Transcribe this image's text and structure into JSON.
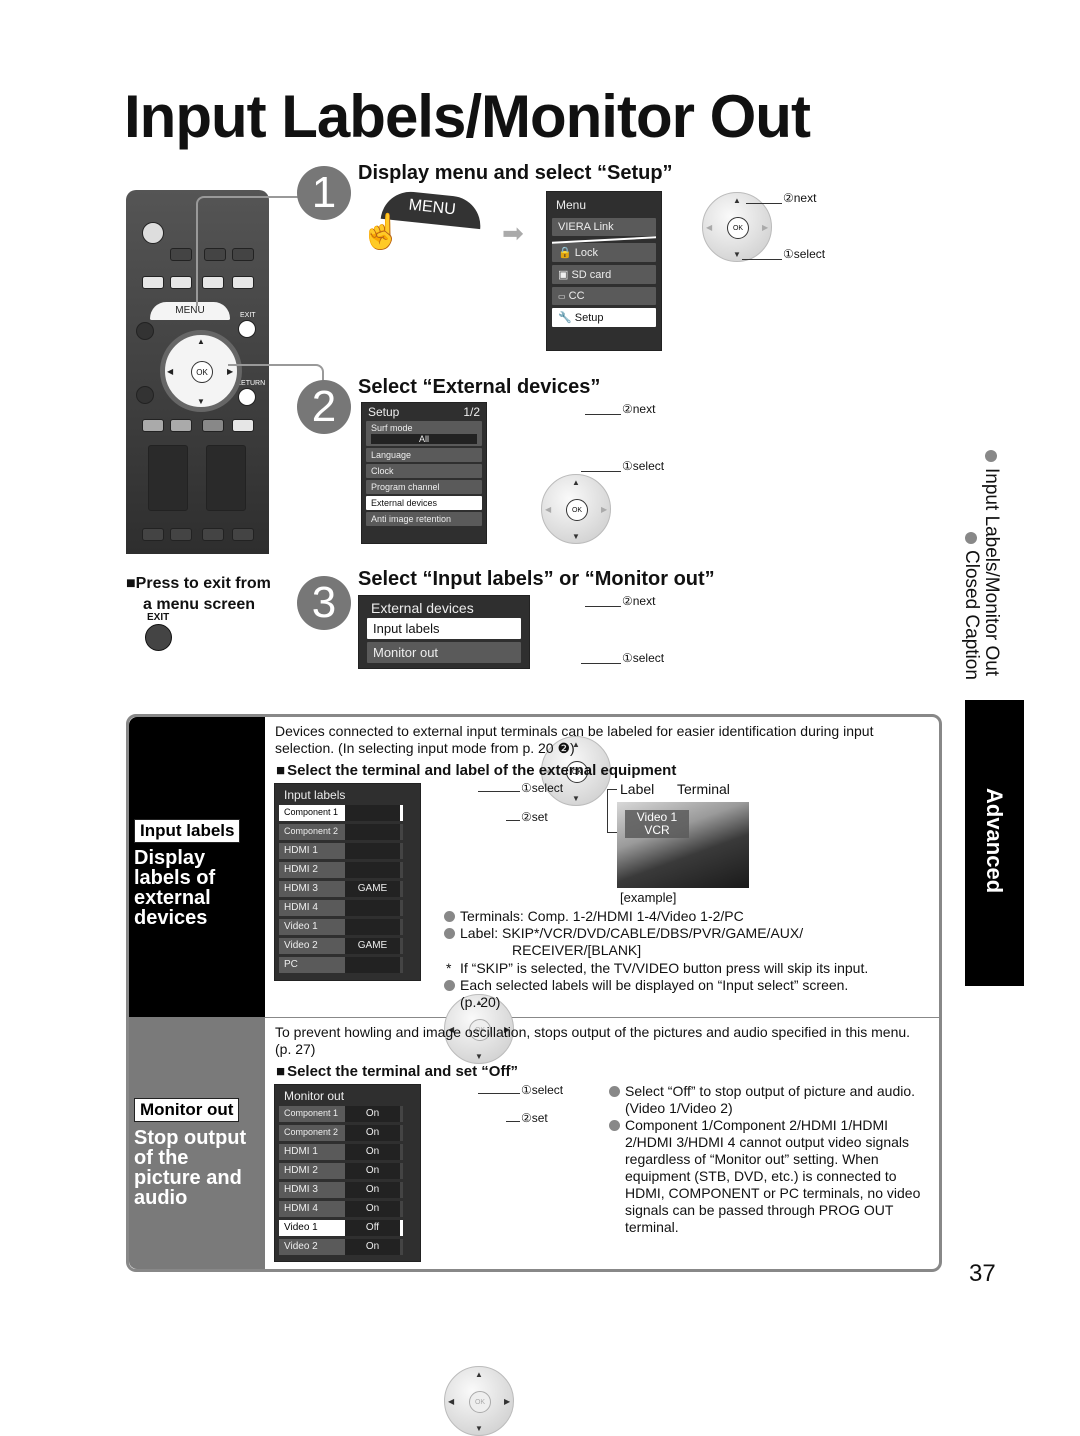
{
  "page": {
    "title": "Input Labels/Monitor Out",
    "page_number": "37"
  },
  "steps": [
    {
      "number": "1",
      "heading": "Display menu and select “Setup”",
      "menu_button_label": "MENU",
      "menu": {
        "title": "Menu",
        "items": [
          {
            "label": "VIERA Link",
            "icon": "",
            "selected": false
          },
          {
            "label": "Lock",
            "icon": "lock-icon",
            "selected": false
          },
          {
            "label": "SD card",
            "icon": "sd-card-icon",
            "selected": false
          },
          {
            "label": "CC",
            "icon": "cc-icon",
            "selected": false
          },
          {
            "label": "Setup",
            "icon": "wrench-icon",
            "selected": true
          }
        ]
      },
      "nav_next": "②next",
      "nav_select": "①select"
    },
    {
      "number": "2",
      "heading": "Select “External devices”",
      "menu": {
        "title": "Setup",
        "page": "1/2",
        "surf_mode_label": "Surf mode",
        "surf_mode_value": "All",
        "items": [
          {
            "label": "Language",
            "selected": false
          },
          {
            "label": "Clock",
            "selected": false
          },
          {
            "label": "Program channel",
            "selected": false
          },
          {
            "label": "External devices",
            "selected": true
          },
          {
            "label": "Anti image retention",
            "selected": false
          }
        ]
      },
      "nav_next": "②next",
      "nav_select": "①select"
    },
    {
      "number": "3",
      "heading": "Select “Input labels” or “Monitor out”",
      "menu": {
        "title": "External devices",
        "items": [
          {
            "label": "Input labels",
            "selected": true
          },
          {
            "label": "Monitor out",
            "selected": false
          }
        ]
      },
      "nav_next": "②next",
      "nav_select": "①select"
    }
  ],
  "remote": {
    "menu_label": "MENU",
    "exit_label": "EXIT",
    "return_label": "RETURN",
    "ok_label": "OK"
  },
  "exit_note": {
    "line1": "Press to exit from",
    "line2": "a menu screen",
    "button_label": "EXIT"
  },
  "input_labels": {
    "tag": "Input labels",
    "band_text": [
      "Display",
      "labels of",
      "external",
      "devices"
    ],
    "intro": "Devices connected to external input terminals can be labeled for easier identification during input selection. (In selecting input mode from p. 20 ❷)",
    "subheading": "Select the terminal and label of the external equipment",
    "menu": {
      "title": "Input labels",
      "rows": [
        {
          "terminal": "Component 1",
          "label": "",
          "selected": true
        },
        {
          "terminal": "Component 2",
          "label": "",
          "selected": false
        },
        {
          "terminal": "HDMI 1",
          "label": "",
          "selected": false
        },
        {
          "terminal": "HDMI 2",
          "label": "",
          "selected": false
        },
        {
          "terminal": "HDMI 3",
          "label": "GAME",
          "selected": false
        },
        {
          "terminal": "HDMI 4",
          "label": "",
          "selected": false
        },
        {
          "terminal": "Video 1",
          "label": "",
          "selected": false
        },
        {
          "terminal": "Video 2",
          "label": "GAME",
          "selected": false
        },
        {
          "terminal": "PC",
          "label": "",
          "selected": false
        }
      ]
    },
    "nav_select": "①select",
    "nav_set": "②set",
    "example": {
      "label_caption": "Label",
      "terminal_caption": "Terminal",
      "overlay_terminal": "Video 1",
      "overlay_label": "VCR",
      "caption": "[example]"
    },
    "notes": [
      {
        "type": "bullet",
        "text": "Terminals:  Comp. 1-2/HDMI 1-4/Video 1-2/PC"
      },
      {
        "type": "bullet",
        "text": "Label:  SKIP*/VCR/DVD/CABLE/DBS/PVR/GAME/AUX/",
        "continuation": "RECEIVER/[BLANK]"
      },
      {
        "type": "star",
        "text": "If “SKIP” is selected, the TV/VIDEO button press will skip its input."
      },
      {
        "type": "bullet",
        "text": "Each selected labels will be displayed on “Input select” screen.",
        "continuation": "(p. 20)"
      }
    ]
  },
  "monitor_out": {
    "tag": "Monitor out",
    "band_text": [
      "Stop output",
      "of the",
      "picture and",
      "audio"
    ],
    "intro": "To prevent howling and image oscillation, stops output of the pictures and audio specified in this menu. (p. 27)",
    "subheading": "Select the terminal and set “Off”",
    "menu": {
      "title": "Monitor out",
      "rows": [
        {
          "terminal": "Component 1",
          "value": "On",
          "selected": false
        },
        {
          "terminal": "Component 2",
          "value": "On",
          "selected": false
        },
        {
          "terminal": "HDMI 1",
          "value": "On",
          "selected": false
        },
        {
          "terminal": "HDMI 2",
          "value": "On",
          "selected": false
        },
        {
          "terminal": "HDMI 3",
          "value": "On",
          "selected": false
        },
        {
          "terminal": "HDMI 4",
          "value": "On",
          "selected": false
        },
        {
          "terminal": "Video 1",
          "value": "Off",
          "selected": true
        },
        {
          "terminal": "Video 2",
          "value": "On",
          "selected": false
        }
      ]
    },
    "nav_select": "①select",
    "nav_set": "②set",
    "notes": [
      {
        "text": "Select “Off” to stop output of picture and audio. (Video 1/Video 2)"
      },
      {
        "text": "Component 1/Component 2/HDMI 1/HDMI 2/HDMI 3/HDMI 4 cannot output video signals regardless of “Monitor out” setting. When equipment (STB, DVD, etc.) is connected to HDMI, COMPONENT or PC terminals, no video signals can be passed through PROG OUT terminal."
      }
    ]
  },
  "sidebar": {
    "topics": [
      "Input Labels/Monitor Out",
      "Closed Caption"
    ],
    "section_tab": "Advanced"
  }
}
